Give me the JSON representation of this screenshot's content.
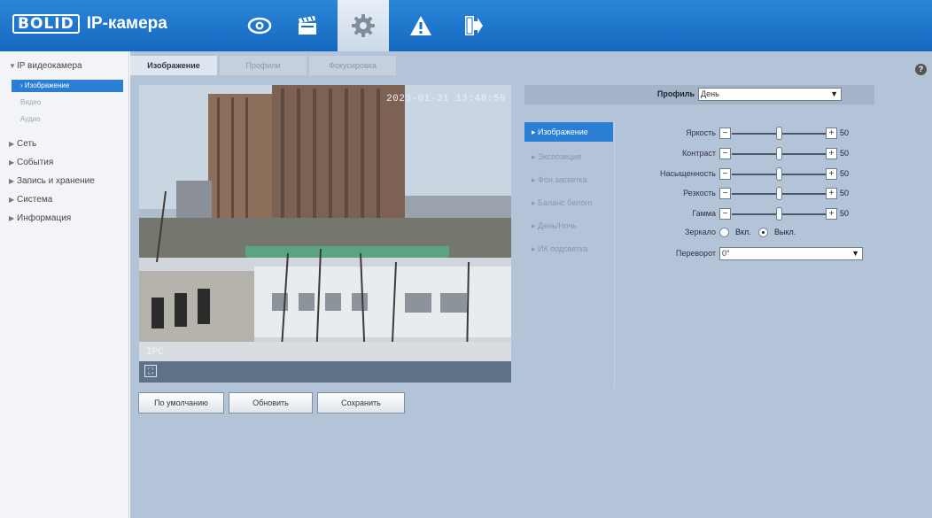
{
  "header": {
    "logo": "BOLID",
    "title": "IP-камера",
    "nav": [
      {
        "name": "live-view",
        "icon": "eye-icon"
      },
      {
        "name": "playback",
        "icon": "clapperboard-icon"
      },
      {
        "name": "settings",
        "icon": "gear-icon",
        "active": true
      },
      {
        "name": "alarm",
        "icon": "warning-icon"
      },
      {
        "name": "logout",
        "icon": "logout-icon"
      }
    ]
  },
  "sidebar": {
    "root": "IP видеокамера",
    "sub": [
      "Изображение",
      "Видео",
      "Аудио"
    ],
    "items": [
      "Сеть",
      "События",
      "Запись и хранение",
      "Система",
      "Информация"
    ]
  },
  "tabs": [
    "Изображение",
    "Профили",
    "Фокусировка"
  ],
  "video": {
    "timestamp": "2023-01-31 13:48:50",
    "camera_name": "IPC"
  },
  "buttons": {
    "default": "По умолчанию",
    "refresh": "Обновить",
    "save": "Сохранить"
  },
  "panel": {
    "profile_label": "Профиль",
    "profile_value": "День",
    "menu": [
      "Изображение",
      "Экспозиция",
      "Фон.засветка",
      "Баланс белого",
      "День/Ночь",
      "ИК подсветка"
    ],
    "sliders": [
      {
        "label": "Яркость",
        "value": 50
      },
      {
        "label": "Контраст",
        "value": 50
      },
      {
        "label": "Насыщенность",
        "value": 50
      },
      {
        "label": "Резкость",
        "value": 50
      },
      {
        "label": "Гамма",
        "value": 50
      }
    ],
    "mirror": {
      "label": "Зеркало",
      "on": "Вкл.",
      "off": "Выкл.",
      "selected": "off"
    },
    "flip": {
      "label": "Переворот",
      "value": "0°"
    }
  },
  "help": "?"
}
